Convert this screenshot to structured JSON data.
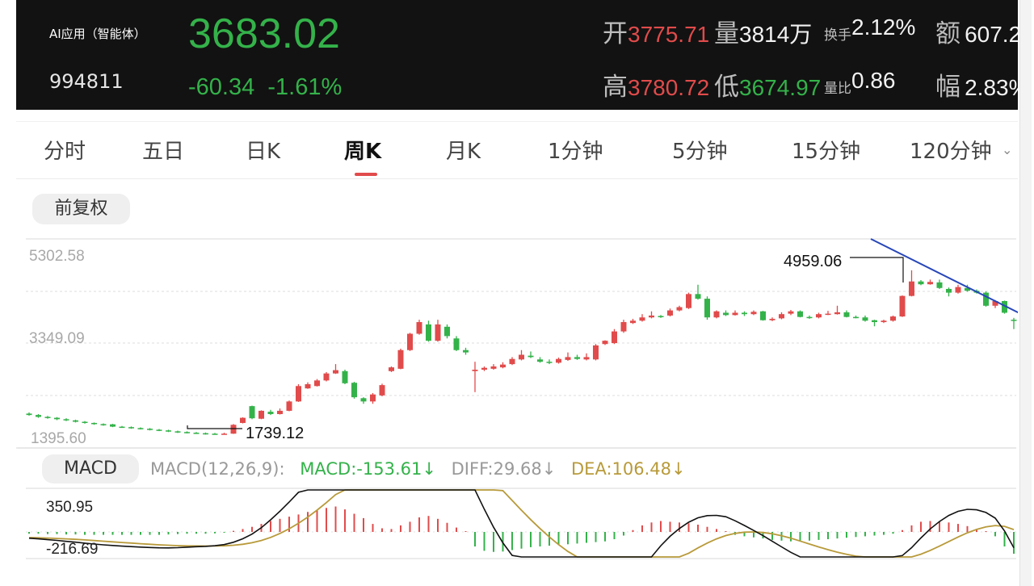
{
  "header": {
    "name": "AI应用（智能体）",
    "code": "994811",
    "price": "3683.02",
    "change": "-60.34",
    "change_pct": "-1.61%",
    "open_label": "开",
    "open": "3775.71",
    "vol_label": "量",
    "vol": "3814万",
    "turnover_label": "换手",
    "turnover": "2.12%",
    "amount_label": "额",
    "amount": "607.2",
    "high_label": "高",
    "high": "3780.72",
    "low_label": "低",
    "low": "3674.97",
    "ratio_label": "量比",
    "ratio": "0.86",
    "amp_label": "幅",
    "amp": "2.83%"
  },
  "tabs": [
    {
      "label": "分时"
    },
    {
      "label": "五日"
    },
    {
      "label": "日K"
    },
    {
      "label": "周K"
    },
    {
      "label": "月K"
    },
    {
      "label": "1分钟"
    },
    {
      "label": "5分钟"
    },
    {
      "label": "15分钟"
    },
    {
      "label": "120分钟"
    }
  ],
  "active_tab": "周K",
  "adjust_label": "前复权",
  "chart_data": {
    "type": "candlestick",
    "ylabels": [
      "5302.58",
      "3349.09",
      "1395.60"
    ],
    "high_marker": "4959.06",
    "low_marker": "1739.12",
    "candles": [
      [
        1890,
        1860,
        1915,
        1845
      ],
      [
        1860,
        1820,
        1880,
        1800
      ],
      [
        1820,
        1800,
        1840,
        1780
      ],
      [
        1800,
        1770,
        1815,
        1750
      ],
      [
        1770,
        1745,
        1790,
        1730
      ],
      [
        1745,
        1715,
        1760,
        1700
      ],
      [
        1715,
        1690,
        1730,
        1675
      ],
      [
        1690,
        1665,
        1700,
        1650
      ],
      [
        1665,
        1645,
        1680,
        1630
      ],
      [
        1660,
        1610,
        1670,
        1600
      ],
      [
        1610,
        1600,
        1625,
        1585
      ],
      [
        1600,
        1580,
        1615,
        1565
      ],
      [
        1580,
        1565,
        1595,
        1550
      ],
      [
        1565,
        1545,
        1580,
        1530
      ],
      [
        1545,
        1530,
        1560,
        1515
      ],
      [
        1530,
        1510,
        1545,
        1495
      ],
      [
        1510,
        1490,
        1525,
        1475
      ],
      [
        1495,
        1480,
        1510,
        1465
      ],
      [
        1480,
        1470,
        1495,
        1455
      ],
      [
        1470,
        1455,
        1485,
        1440
      ],
      [
        1460,
        1455,
        1475,
        1440
      ],
      [
        1455,
        1460,
        1480,
        1445
      ],
      [
        1460,
        1650,
        1665,
        1455
      ],
      [
        1690,
        1800,
        1810,
        1680
      ],
      [
        2050,
        1790,
        2060,
        1770
      ],
      [
        1780,
        1950,
        1960,
        1770
      ],
      [
        1930,
        1880,
        1970,
        1860
      ],
      [
        1880,
        1950,
        2000,
        1870
      ],
      [
        1950,
        2150,
        2170,
        1940
      ],
      [
        2150,
        2480,
        2520,
        2140
      ],
      [
        2430,
        2520,
        2560,
        2420
      ],
      [
        2480,
        2600,
        2630,
        2470
      ],
      [
        2600,
        2750,
        2780,
        2580
      ],
      [
        2750,
        2820,
        2950,
        2740
      ],
      [
        2800,
        2540,
        2830,
        2520
      ],
      [
        2550,
        2240,
        2570,
        2210
      ],
      [
        2220,
        2150,
        2240,
        2100
      ],
      [
        2150,
        2300,
        2330,
        2100
      ],
      [
        2280,
        2500,
        2530,
        2260
      ],
      [
        2800,
        2880,
        2900,
        2780
      ],
      [
        2850,
        3250,
        3280,
        2840
      ],
      [
        3250,
        3600,
        3620,
        3230
      ],
      [
        3600,
        3850,
        3900,
        3580
      ],
      [
        3800,
        3450,
        3880,
        3430
      ],
      [
        3450,
        3800,
        3900,
        3430
      ],
      [
        3750,
        3550,
        3800,
        3500
      ],
      [
        3500,
        3250,
        3550,
        3230
      ],
      [
        3250,
        3200,
        3300,
        3150
      ],
      [
        2800,
        2830,
        3000,
        2350
      ],
      [
        2830,
        2870,
        2900,
        2800
      ],
      [
        2850,
        2900,
        2950,
        2830
      ],
      [
        2880,
        2940,
        2990,
        2860
      ],
      [
        2950,
        3060,
        3100,
        2930
      ],
      [
        3050,
        3150,
        3250,
        3030
      ],
      [
        3130,
        3100,
        3220,
        3080
      ],
      [
        3050,
        3000,
        3100,
        2980
      ],
      [
        3000,
        2980,
        3050,
        2950
      ],
      [
        2980,
        3060,
        3090,
        2960
      ],
      [
        3040,
        3100,
        3200,
        3020
      ],
      [
        3100,
        3060,
        3150,
        3040
      ],
      [
        3050,
        3100,
        3180,
        3030
      ],
      [
        3050,
        3350,
        3380,
        3030
      ],
      [
        3380,
        3450,
        3460,
        3360
      ],
      [
        3400,
        3650,
        3700,
        3380
      ],
      [
        3650,
        3850,
        3900,
        3620
      ],
      [
        3830,
        3880,
        3920,
        3810
      ],
      [
        3880,
        3950,
        4020,
        3860
      ],
      [
        3950,
        3990,
        4080,
        3930
      ],
      [
        3980,
        3970,
        4000,
        3940
      ],
      [
        3990,
        4100,
        4140,
        3970
      ],
      [
        4100,
        4170,
        4200,
        4080
      ],
      [
        4150,
        4450,
        4480,
        4130
      ],
      [
        4450,
        4350,
        4650,
        4330
      ],
      [
        4350,
        3950,
        4400,
        3900
      ],
      [
        3950,
        4080,
        4100,
        3930
      ],
      [
        4050,
        4000,
        4100,
        3980
      ],
      [
        4000,
        4050,
        4100,
        3990
      ],
      [
        4050,
        4020,
        4080,
        3980
      ],
      [
        4020,
        4070,
        4100,
        4000
      ],
      [
        4080,
        3890,
        4090,
        3880
      ],
      [
        3890,
        3920,
        3950,
        3870
      ],
      [
        3930,
        4020,
        4060,
        3910
      ],
      [
        4030,
        4080,
        4110,
        4000
      ],
      [
        4080,
        3960,
        4100,
        3950
      ],
      [
        3960,
        3940,
        3990,
        3920
      ],
      [
        3950,
        4020,
        4050,
        3930
      ],
      [
        4020,
        4030,
        4090,
        4000
      ],
      [
        4020,
        4060,
        4200,
        4010
      ],
      [
        4060,
        3960,
        4100,
        3950
      ],
      [
        3960,
        3950,
        3990,
        3930
      ],
      [
        3950,
        3880,
        3990,
        3860
      ],
      [
        3890,
        3850,
        3900,
        3760
      ],
      [
        3850,
        3880,
        3900,
        3830
      ],
      [
        3880,
        3970,
        3990,
        3860
      ],
      [
        3970,
        4410,
        4420,
        3960
      ],
      [
        4410,
        4720,
        4959,
        4400
      ],
      [
        4720,
        4660,
        4750,
        4640
      ],
      [
        4660,
        4710,
        4760,
        4650
      ],
      [
        4700,
        4580,
        4760,
        4560
      ],
      [
        4560,
        4480,
        4590,
        4400
      ],
      [
        4480,
        4600,
        4650,
        4460
      ],
      [
        4580,
        4520,
        4650,
        4500
      ],
      [
        4520,
        4480,
        4550,
        4460
      ],
      [
        4480,
        4200,
        4510,
        4180
      ],
      [
        4200,
        4300,
        4320,
        4150
      ],
      [
        4300,
        4050,
        4310,
        4030
      ],
      [
        3900,
        3880,
        3940,
        3700
      ],
      [
        3880,
        3700,
        3950,
        3650
      ]
    ]
  },
  "macd": {
    "label": "MACD",
    "params": "MACD(12,26,9):",
    "macd_value": "MACD:-153.61↓",
    "diff_value": "DIFF:29.68↓",
    "dea_value": "DEA:106.48↓",
    "ylabels": [
      "350.95",
      "-216.69"
    ],
    "bars": [
      -5,
      -5,
      -6,
      -6,
      -7,
      -7,
      -8,
      -8,
      -8,
      -8,
      -8,
      -8,
      -8,
      -8,
      -8,
      -7,
      -6,
      -5,
      -5,
      -5,
      -4,
      -2,
      3,
      8,
      14,
      22,
      30,
      36,
      42,
      48,
      55,
      60,
      66,
      70,
      62,
      50,
      38,
      22,
      10,
      8,
      18,
      28,
      40,
      44,
      36,
      25,
      12,
      2,
      -40,
      -52,
      -55,
      -54,
      -50,
      -46,
      -42,
      -40,
      -38,
      -36,
      -34,
      -32,
      -30,
      -28,
      -26,
      -20,
      -10,
      5,
      18,
      26,
      30,
      28,
      26,
      24,
      20,
      14,
      8,
      2,
      -8,
      -12,
      -15,
      -18,
      -22,
      -24,
      -26,
      -26,
      -24,
      -22,
      -20,
      -18,
      -16,
      -14,
      -12,
      -10,
      -8,
      -5,
      5,
      18,
      28,
      30,
      28,
      26,
      22,
      16,
      8,
      0,
      -12,
      -40,
      -60
    ]
  },
  "colors": {
    "up": "#e14b4b",
    "down": "#34b24a",
    "diff": "#111111",
    "dea": "#b89a3a",
    "trend": "#2746b8"
  }
}
